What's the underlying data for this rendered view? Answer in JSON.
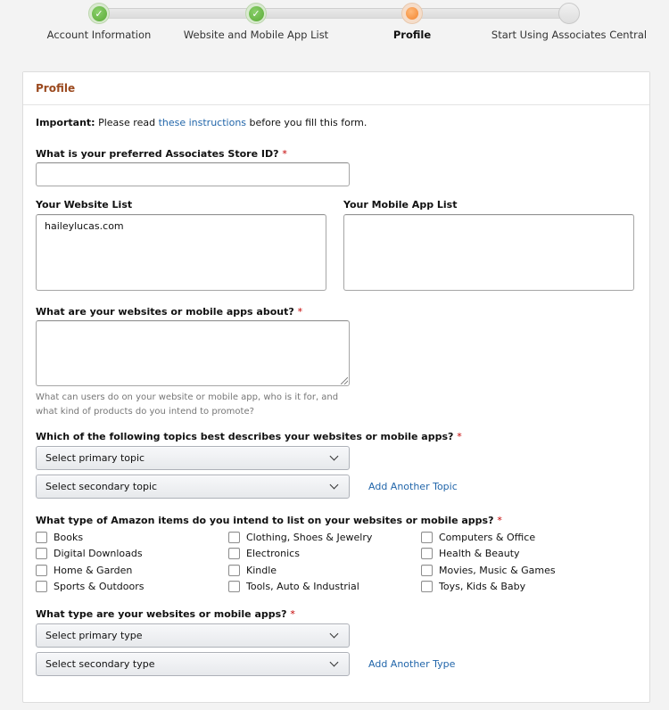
{
  "stepper": {
    "steps": [
      {
        "label": "Account Information",
        "status": "complete"
      },
      {
        "label": "Website and Mobile App List",
        "status": "complete"
      },
      {
        "label": "Profile",
        "status": "current"
      },
      {
        "label": "Start Using Associates Central",
        "status": "upcoming"
      }
    ],
    "check_glyph": "✓"
  },
  "panel": {
    "title": "Profile",
    "important": {
      "bold": "Important:",
      "before": " Please read ",
      "link": "these instructions",
      "after": " before you fill this form."
    },
    "store_id": {
      "label": "What is your preferred Associates Store ID?",
      "required": "*",
      "value": ""
    },
    "website_list": {
      "label": "Your Website List",
      "value": "haileylucas.com"
    },
    "mobile_app_list": {
      "label": "Your Mobile App List",
      "value": ""
    },
    "about": {
      "label": "What are your websites or mobile apps about?",
      "required": "*",
      "value": "",
      "hint_line1": "What can users do on your website or mobile app, who is it for, and",
      "hint_line2": "what kind of products do you intend to promote?"
    },
    "topics": {
      "label": "Which of the following topics best describes your websites or mobile apps?",
      "required": "*",
      "primary": "Select primary topic",
      "secondary": "Select secondary topic",
      "add_link": "Add Another Topic"
    },
    "items": {
      "label": "What type of Amazon items do you intend to list on your websites or mobile apps?",
      "required": "*",
      "options": [
        {
          "label": "Books",
          "checked": false
        },
        {
          "label": "Clothing, Shoes & Jewelry",
          "checked": false
        },
        {
          "label": "Computers & Office",
          "checked": false
        },
        {
          "label": "Digital Downloads",
          "checked": false
        },
        {
          "label": "Electronics",
          "checked": false
        },
        {
          "label": "Health & Beauty",
          "checked": false
        },
        {
          "label": "Home & Garden",
          "checked": false
        },
        {
          "label": "Kindle",
          "checked": false
        },
        {
          "label": "Movies, Music & Games",
          "checked": false
        },
        {
          "label": "Sports & Outdoors",
          "checked": false
        },
        {
          "label": "Tools, Auto & Industrial",
          "checked": false
        },
        {
          "label": "Toys, Kids & Baby",
          "checked": false
        }
      ]
    },
    "types": {
      "label": "What type are your websites or mobile apps?",
      "required": "*",
      "primary": "Select primary type",
      "secondary": "Select secondary type",
      "add_link": "Add Another Type"
    }
  },
  "colors": {
    "accent_title": "#9b4a1f",
    "link": "#2266aa",
    "required": "#c40000",
    "step_complete": "#5aa936",
    "step_current": "#f2852e"
  }
}
